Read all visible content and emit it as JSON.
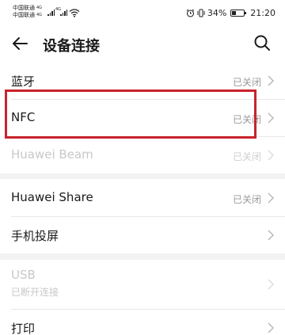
{
  "status_bar": {
    "carrier1": "中国联通",
    "carrier2": "中国联通",
    "carrier1_tag": "4G",
    "carrier2_tag": "4G",
    "net1": "4G",
    "net2": "4G",
    "battery_percent": "34%",
    "battery_level": 0.34,
    "time": "21:20"
  },
  "header": {
    "title": "设备连接"
  },
  "groups": [
    {
      "rows": [
        {
          "label": "蓝牙",
          "status": "已关闭",
          "enabled": true
        },
        {
          "label": "NFC",
          "status": "已关闭",
          "enabled": true,
          "highlighted": true
        },
        {
          "label": "Huawei Beam",
          "status": "已关闭",
          "enabled": false
        }
      ]
    },
    {
      "rows": [
        {
          "label": "Huawei Share",
          "status": "已关闭",
          "enabled": true
        },
        {
          "label": "手机投屏",
          "status": "",
          "enabled": true
        }
      ]
    },
    {
      "rows": [
        {
          "label": "USB",
          "sub": "已断开连接",
          "enabled": false
        },
        {
          "label": "打印",
          "status": "",
          "enabled": true
        }
      ]
    }
  ],
  "colors": {
    "highlight_border": "#c8232c",
    "background": "#f2f2f2",
    "status_gray": "#9a9a9a"
  }
}
